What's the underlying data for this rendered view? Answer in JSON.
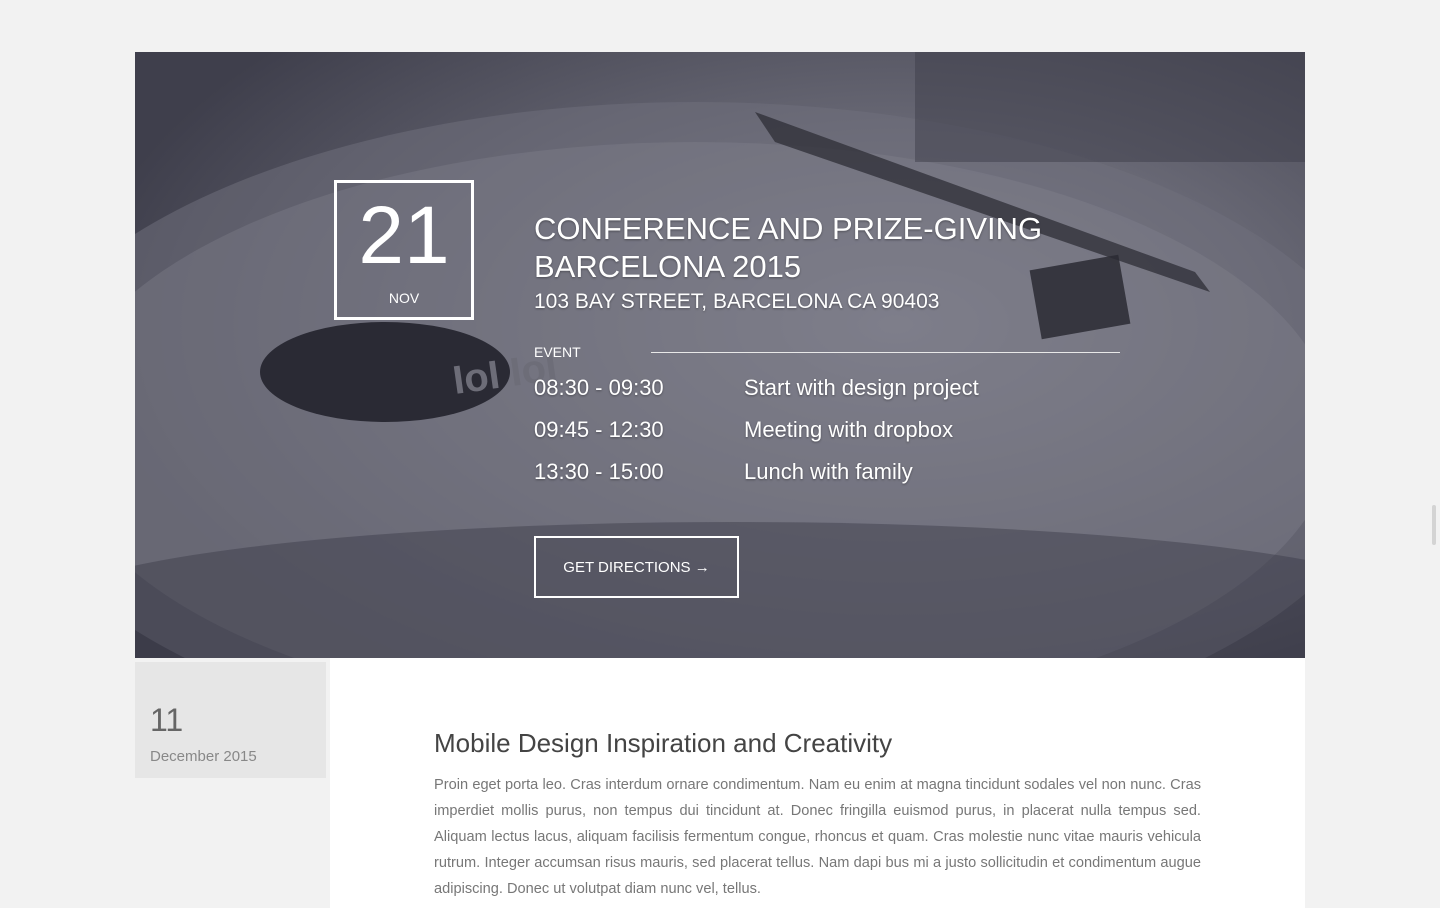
{
  "event": {
    "date_day": "21",
    "date_month": "NOV",
    "title_line1": "CONFERENCE AND PRIZE-GIVING",
    "title_line2": "BARCELONA 2015",
    "address": "103 BAY STREET, BARCELONA CA 90403",
    "section_label": "EVENT",
    "schedule": [
      {
        "time": "08:30 - 09:30",
        "desc": "Start with design project"
      },
      {
        "time": "09:45 - 12:30",
        "desc": "Meeting with dropbox"
      },
      {
        "time": "13:30 - 15:00",
        "desc": "Lunch with family"
      }
    ],
    "directions_label": "GET DIRECTIONS →",
    "record_label_text": "IoI IoI"
  },
  "post": {
    "date_day": "11",
    "date_month": "December 2015",
    "title": "Mobile Design Inspiration and Creativity",
    "body": "Proin eget porta leo. Cras interdum ornare condimentum. Nam eu enim at magna tincidunt sodales vel non nunc. Cras imperdiet mollis purus, non tempus dui tincidunt at. Donec fringilla euismod purus, in placerat nulla tempus sed. Aliquam lectus lacus, aliquam facilisis fermentum congue, rhoncus et quam. Cras molestie nunc vitae mauris vehicula rutrum. Integer accumsan risus mauris, sed placerat tellus. Nam dapi bus mi a justo sollicitudin et condimentum augue adipiscing. Donec ut volutpat diam nunc vel, tellus."
  },
  "colors": {
    "page_bg": "#f2f2f2",
    "hero_overlay": "#4a4a58",
    "text_light": "#ffffff",
    "post_title": "#444444",
    "post_body": "#777777"
  }
}
